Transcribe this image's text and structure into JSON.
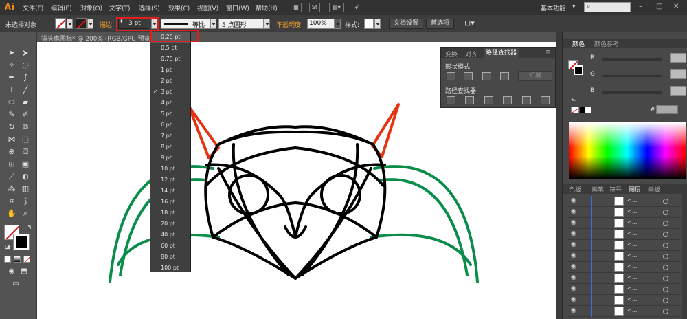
{
  "menubar": {
    "logo": "Ai",
    "menus": [
      "文件(F)",
      "编辑(E)",
      "对象(O)",
      "文字(T)",
      "选择(S)",
      "效果(C)",
      "视图(V)",
      "窗口(W)",
      "帮助(H)"
    ],
    "st_label": "St",
    "workspace": "基本功能",
    "search_placeholder": "",
    "window_controls": [
      "–",
      "□",
      "✕"
    ]
  },
  "ctrlbar": {
    "selection_label": "未选择对象",
    "stroke_label": "描边:",
    "stroke_value": "3 pt",
    "line_style": "等比",
    "brush": "5 点圆形",
    "opacity_label": "不透明度:",
    "opacity_value": "100%",
    "style_label": "样式:",
    "doc_setup": "文档设置",
    "preferences": "首选项"
  },
  "doc_tab": {
    "title": "猫头鹰图标* @ 200% (RGB/GPU 预览)"
  },
  "stroke_dropdown": {
    "items": [
      "0.25 pt",
      "0.5 pt",
      "0.75 pt",
      "1 pt",
      "2 pt",
      "3 pt",
      "4 pt",
      "5 pt",
      "6 pt",
      "7 pt",
      "8 pt",
      "9 pt",
      "10 pt",
      "12 pt",
      "14 pt",
      "16 pt",
      "18 pt",
      "20 pt",
      "40 pt",
      "60 pt",
      "80 pt",
      "100 pt"
    ],
    "checked": "3 pt",
    "highlighted": "0.25 pt"
  },
  "pathfinder": {
    "tabs": [
      "变换",
      "对齐",
      "路径查找器"
    ],
    "active_tab": "路径查找器",
    "shape_modes": "形状模式:",
    "expand": "扩展",
    "pathfinders": "路径查找器:"
  },
  "color_panel": {
    "tabs": [
      "颜色",
      "颜色参考"
    ],
    "channels": [
      "R",
      "G",
      "B"
    ],
    "hex_symbol": "#"
  },
  "layers_panel": {
    "tabs": [
      "色板",
      "画笔",
      "符号",
      "图层",
      "画板"
    ],
    "active_tab": "图层",
    "row_label": "<..."
  },
  "artwork": {
    "colors": {
      "head": "#000000",
      "ears": "#e63212",
      "wings": "#0a8c4a"
    }
  }
}
